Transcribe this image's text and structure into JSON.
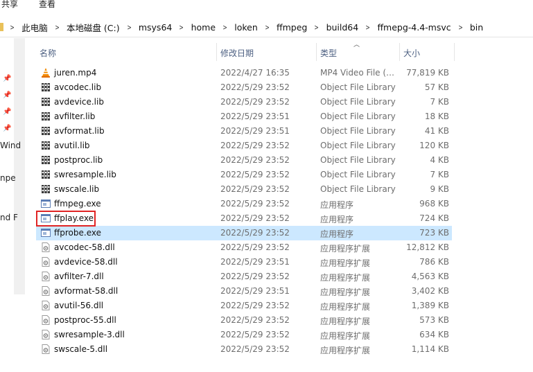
{
  "ribbon": {
    "share": "共享",
    "view": "查看"
  },
  "address": {
    "crumbs": [
      "此电脑",
      "本地磁盘 (C:)",
      "msys64",
      "home",
      "loken",
      "ffmpeg",
      "build64",
      "ffmepg-4.4-msvc",
      "bin"
    ]
  },
  "left_pane": {
    "text1": "Wind",
    "text2": "npe",
    "text3": "nd F"
  },
  "columns": {
    "name": "名称",
    "date": "修改日期",
    "type": "类型",
    "size": "大小"
  },
  "files": [
    {
      "name": "juren.mp4",
      "date": "2022/4/27 16:35",
      "type": "MP4 Video File (…",
      "size": "77,819 KB",
      "icon": "vlc-cone-icon"
    },
    {
      "name": "avcodec.lib",
      "date": "2022/5/29 23:52",
      "type": "Object File Library",
      "size": "57 KB",
      "icon": "library-file-icon"
    },
    {
      "name": "avdevice.lib",
      "date": "2022/5/29 23:52",
      "type": "Object File Library",
      "size": "7 KB",
      "icon": "library-file-icon"
    },
    {
      "name": "avfilter.lib",
      "date": "2022/5/29 23:51",
      "type": "Object File Library",
      "size": "18 KB",
      "icon": "library-file-icon"
    },
    {
      "name": "avformat.lib",
      "date": "2022/5/29 23:51",
      "type": "Object File Library",
      "size": "41 KB",
      "icon": "library-file-icon"
    },
    {
      "name": "avutil.lib",
      "date": "2022/5/29 23:52",
      "type": "Object File Library",
      "size": "120 KB",
      "icon": "library-file-icon"
    },
    {
      "name": "postproc.lib",
      "date": "2022/5/29 23:52",
      "type": "Object File Library",
      "size": "4 KB",
      "icon": "library-file-icon"
    },
    {
      "name": "swresample.lib",
      "date": "2022/5/29 23:52",
      "type": "Object File Library",
      "size": "7 KB",
      "icon": "library-file-icon"
    },
    {
      "name": "swscale.lib",
      "date": "2022/5/29 23:52",
      "type": "Object File Library",
      "size": "9 KB",
      "icon": "library-file-icon"
    },
    {
      "name": "ffmpeg.exe",
      "date": "2022/5/29 23:52",
      "type": "应用程序",
      "size": "968 KB",
      "icon": "exe-window-icon"
    },
    {
      "name": "ffplay.exe",
      "date": "2022/5/29 23:52",
      "type": "应用程序",
      "size": "724 KB",
      "icon": "exe-window-icon"
    },
    {
      "name": "ffprobe.exe",
      "date": "2022/5/29 23:52",
      "type": "应用程序",
      "size": "723 KB",
      "icon": "exe-window-icon"
    },
    {
      "name": "avcodec-58.dll",
      "date": "2022/5/29 23:52",
      "type": "应用程序扩展",
      "size": "12,812 KB",
      "icon": "dll-gear-icon"
    },
    {
      "name": "avdevice-58.dll",
      "date": "2022/5/29 23:51",
      "type": "应用程序扩展",
      "size": "786 KB",
      "icon": "dll-gear-icon"
    },
    {
      "name": "avfilter-7.dll",
      "date": "2022/5/29 23:52",
      "type": "应用程序扩展",
      "size": "4,563 KB",
      "icon": "dll-gear-icon"
    },
    {
      "name": "avformat-58.dll",
      "date": "2022/5/29 23:51",
      "type": "应用程序扩展",
      "size": "3,402 KB",
      "icon": "dll-gear-icon"
    },
    {
      "name": "avutil-56.dll",
      "date": "2022/5/29 23:52",
      "type": "应用程序扩展",
      "size": "1,389 KB",
      "icon": "dll-gear-icon"
    },
    {
      "name": "postproc-55.dll",
      "date": "2022/5/29 23:52",
      "type": "应用程序扩展",
      "size": "573 KB",
      "icon": "dll-gear-icon"
    },
    {
      "name": "swresample-3.dll",
      "date": "2022/5/29 23:52",
      "type": "应用程序扩展",
      "size": "634 KB",
      "icon": "dll-gear-icon"
    },
    {
      "name": "swscale-5.dll",
      "date": "2022/5/29 23:52",
      "type": "应用程序扩展",
      "size": "1,114 KB",
      "icon": "dll-gear-icon"
    }
  ],
  "selected_index": 11,
  "highlighted_index": 10,
  "colors": {
    "selection": "#cce8ff",
    "highlight_box": "#e02424",
    "header_text": "#4d6082"
  }
}
